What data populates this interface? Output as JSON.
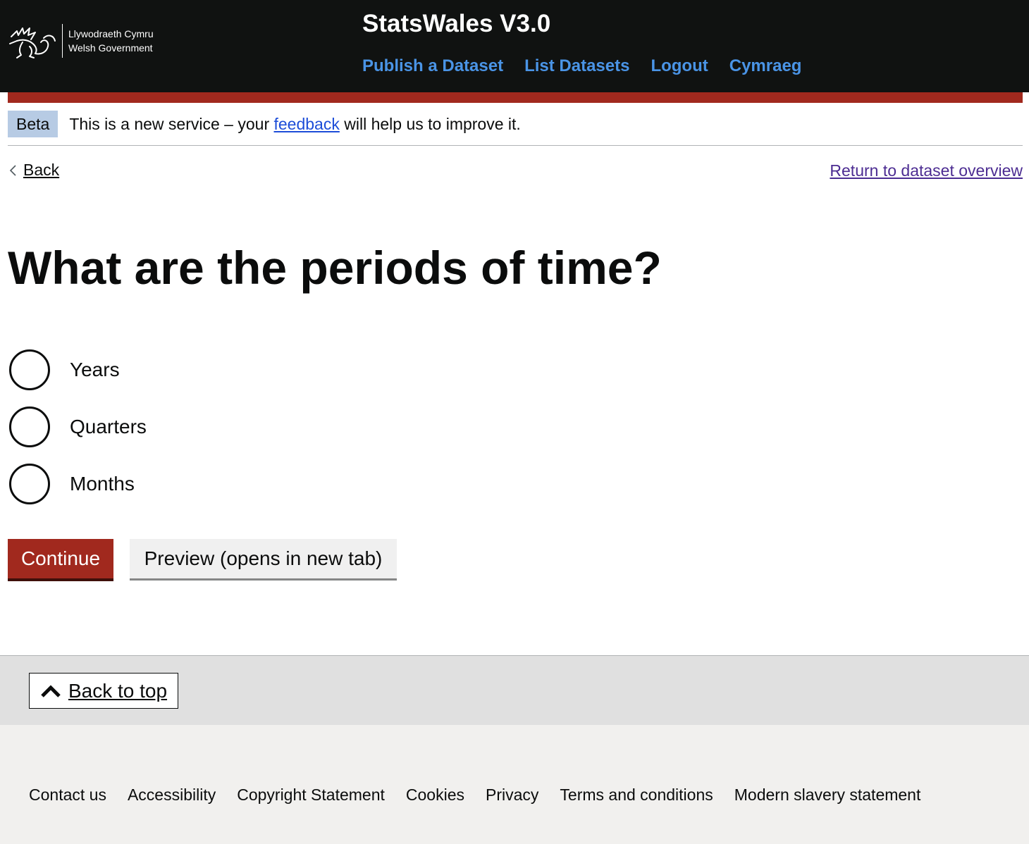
{
  "header": {
    "logo_line1": "Llywodraeth Cymru",
    "logo_line2": "Welsh Government",
    "site_title": "StatsWales V3.0",
    "nav": [
      {
        "label": "Publish a Dataset"
      },
      {
        "label": "List Datasets"
      },
      {
        "label": "Logout"
      },
      {
        "label": "Cymraeg"
      }
    ]
  },
  "beta": {
    "tag": "Beta",
    "text_before": "This is a new service – your ",
    "link": "feedback",
    "text_after": " will help us to improve it."
  },
  "navigation": {
    "back": "Back",
    "return": "Return to dataset overview"
  },
  "page": {
    "title": "What are the periods of time?"
  },
  "options": [
    {
      "label": "Years"
    },
    {
      "label": "Quarters"
    },
    {
      "label": "Months"
    }
  ],
  "buttons": {
    "continue": "Continue",
    "preview": "Preview (opens in new tab)"
  },
  "back_to_top": "Back to top",
  "footer": {
    "links": [
      {
        "label": "Contact us"
      },
      {
        "label": "Accessibility"
      },
      {
        "label": "Copyright Statement"
      },
      {
        "label": "Cookies"
      },
      {
        "label": "Privacy"
      },
      {
        "label": "Terms and conditions"
      },
      {
        "label": "Modern slavery statement"
      }
    ]
  },
  "colors": {
    "header_bg": "#101211",
    "accent_red": "#a1291e",
    "nav_link": "#4a94e6",
    "beta_tag": "#b7cbe4"
  }
}
